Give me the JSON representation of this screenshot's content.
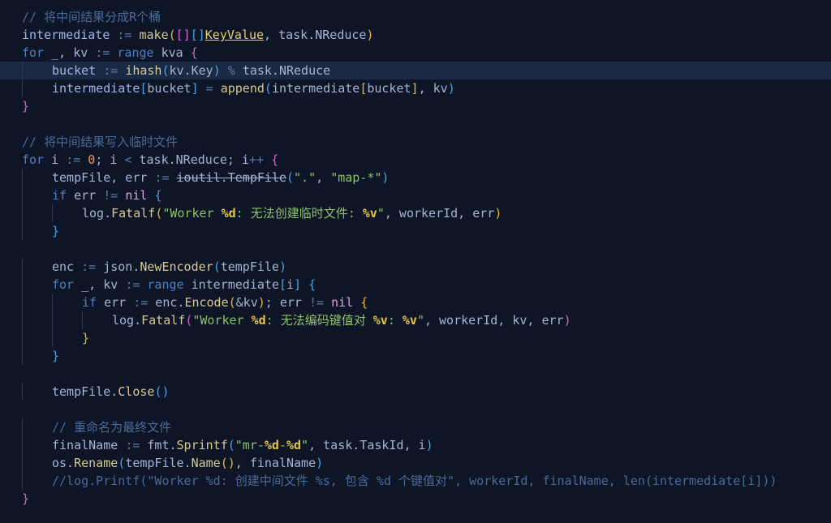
{
  "colors": {
    "background": "#0e1526",
    "line_highlight": "#1a2a44",
    "comment": "#4b6a98",
    "keyword": "#4d7fc4",
    "string": "#8cc36a",
    "function": "#d8c896",
    "bracket_gold": "#e6b93a",
    "bracket_magenta": "#d166c6",
    "bracket_blue": "#4aa3e0"
  },
  "editor": {
    "highlighted_line": 3,
    "lines": [
      {
        "indent": 0,
        "tokens": [
          {
            "t": "// 将中间结果分成R个桶",
            "c": "comment"
          }
        ]
      },
      {
        "indent": 0,
        "tokens": [
          {
            "t": "intermediate",
            "c": "var"
          },
          {
            "t": " := ",
            "c": "op"
          },
          {
            "t": "make",
            "c": "func"
          },
          {
            "t": "(",
            "c": "bracket1"
          },
          {
            "t": "[]",
            "c": "bracket2"
          },
          {
            "t": "[]",
            "c": "bracket3"
          },
          {
            "t": "KeyValue",
            "c": "type"
          },
          {
            "t": ", task.NReduce",
            "c": "plain"
          },
          {
            "t": ")",
            "c": "bracket1"
          }
        ]
      },
      {
        "indent": 0,
        "tokens": [
          {
            "t": "for",
            "c": "keyword"
          },
          {
            "t": " _, kv ",
            "c": "plain"
          },
          {
            "t": ":=",
            "c": "op"
          },
          {
            "t": " ",
            "c": "plain"
          },
          {
            "t": "range",
            "c": "keyword"
          },
          {
            "t": " kva ",
            "c": "plain"
          },
          {
            "t": "{",
            "c": "bracket2"
          }
        ]
      },
      {
        "indent": 1,
        "tokens": [
          {
            "t": "bucket",
            "c": "var"
          },
          {
            "t": " := ",
            "c": "op"
          },
          {
            "t": "ihash",
            "c": "func"
          },
          {
            "t": "(",
            "c": "bracket3"
          },
          {
            "t": "kv.Key",
            "c": "plain"
          },
          {
            "t": ")",
            "c": "bracket3"
          },
          {
            "t": " % ",
            "c": "op"
          },
          {
            "t": "task.NReduce",
            "c": "plain"
          }
        ]
      },
      {
        "indent": 1,
        "tokens": [
          {
            "t": "intermediate",
            "c": "var"
          },
          {
            "t": "[",
            "c": "bracket3"
          },
          {
            "t": "bucket",
            "c": "plain"
          },
          {
            "t": "]",
            "c": "bracket3"
          },
          {
            "t": " = ",
            "c": "op"
          },
          {
            "t": "append",
            "c": "func"
          },
          {
            "t": "(",
            "c": "bracket3"
          },
          {
            "t": "intermediate",
            "c": "plain"
          },
          {
            "t": "[",
            "c": "bracket1"
          },
          {
            "t": "bucket",
            "c": "plain"
          },
          {
            "t": "]",
            "c": "bracket1"
          },
          {
            "t": ", kv",
            "c": "plain"
          },
          {
            "t": ")",
            "c": "bracket3"
          }
        ]
      },
      {
        "indent": 0,
        "tokens": [
          {
            "t": "}",
            "c": "bracket2"
          }
        ]
      },
      {
        "indent": 0,
        "tokens": []
      },
      {
        "indent": 0,
        "tokens": [
          {
            "t": "// 将中间结果写入临时文件",
            "c": "comment"
          }
        ]
      },
      {
        "indent": 0,
        "tokens": [
          {
            "t": "for",
            "c": "keyword"
          },
          {
            "t": " i ",
            "c": "plain"
          },
          {
            "t": ":=",
            "c": "op"
          },
          {
            "t": " ",
            "c": "plain"
          },
          {
            "t": "0",
            "c": "number"
          },
          {
            "t": "; i ",
            "c": "plain"
          },
          {
            "t": "<",
            "c": "op"
          },
          {
            "t": " task.NReduce; i",
            "c": "plain"
          },
          {
            "t": "++",
            "c": "op"
          },
          {
            "t": " ",
            "c": "plain"
          },
          {
            "t": "{",
            "c": "bracket2"
          }
        ]
      },
      {
        "indent": 1,
        "tokens": [
          {
            "t": "tempFile, err ",
            "c": "plain"
          },
          {
            "t": ":=",
            "c": "op"
          },
          {
            "t": " ",
            "c": "plain"
          },
          {
            "t": "ioutil.TempFile",
            "c": "strike"
          },
          {
            "t": "(",
            "c": "bracket3"
          },
          {
            "t": "\".\"",
            "c": "string"
          },
          {
            "t": ", ",
            "c": "plain"
          },
          {
            "t": "\"map-*\"",
            "c": "string"
          },
          {
            "t": ")",
            "c": "bracket3"
          }
        ]
      },
      {
        "indent": 1,
        "tokens": [
          {
            "t": "if",
            "c": "keyword"
          },
          {
            "t": " err ",
            "c": "plain"
          },
          {
            "t": "!=",
            "c": "op"
          },
          {
            "t": " ",
            "c": "plain"
          },
          {
            "t": "nil",
            "c": "nil"
          },
          {
            "t": " ",
            "c": "plain"
          },
          {
            "t": "{",
            "c": "bracket3"
          }
        ]
      },
      {
        "indent": 2,
        "tokens": [
          {
            "t": "log.",
            "c": "plain"
          },
          {
            "t": "Fatalf",
            "c": "func"
          },
          {
            "t": "(",
            "c": "bracket1"
          },
          {
            "t": "\"Worker ",
            "c": "string"
          },
          {
            "t": "%d",
            "c": "format"
          },
          {
            "t": ": 无法创建临时文件: ",
            "c": "string"
          },
          {
            "t": "%v",
            "c": "format"
          },
          {
            "t": "\"",
            "c": "string"
          },
          {
            "t": ", workerId, err",
            "c": "plain"
          },
          {
            "t": ")",
            "c": "bracket1"
          }
        ]
      },
      {
        "indent": 1,
        "tokens": [
          {
            "t": "}",
            "c": "bracket3"
          }
        ]
      },
      {
        "indent": 0,
        "tokens": []
      },
      {
        "indent": 1,
        "tokens": [
          {
            "t": "enc ",
            "c": "plain"
          },
          {
            "t": ":=",
            "c": "op"
          },
          {
            "t": " json.",
            "c": "plain"
          },
          {
            "t": "NewEncoder",
            "c": "func"
          },
          {
            "t": "(",
            "c": "bracket3"
          },
          {
            "t": "tempFile",
            "c": "plain"
          },
          {
            "t": ")",
            "c": "bracket3"
          }
        ]
      },
      {
        "indent": 1,
        "tokens": [
          {
            "t": "for",
            "c": "keyword"
          },
          {
            "t": " _, kv ",
            "c": "plain"
          },
          {
            "t": ":=",
            "c": "op"
          },
          {
            "t": " ",
            "c": "plain"
          },
          {
            "t": "range",
            "c": "keyword"
          },
          {
            "t": " intermediate",
            "c": "plain"
          },
          {
            "t": "[",
            "c": "bracket3"
          },
          {
            "t": "i",
            "c": "plain"
          },
          {
            "t": "]",
            "c": "bracket3"
          },
          {
            "t": " ",
            "c": "plain"
          },
          {
            "t": "{",
            "c": "bracket3"
          }
        ]
      },
      {
        "indent": 2,
        "tokens": [
          {
            "t": "if",
            "c": "keyword"
          },
          {
            "t": " err ",
            "c": "plain"
          },
          {
            "t": ":=",
            "c": "op"
          },
          {
            "t": " enc.",
            "c": "plain"
          },
          {
            "t": "Encode",
            "c": "func"
          },
          {
            "t": "(",
            "c": "bracket1"
          },
          {
            "t": "&kv",
            "c": "plain"
          },
          {
            "t": ")",
            "c": "bracket1"
          },
          {
            "t": "; err ",
            "c": "plain"
          },
          {
            "t": "!=",
            "c": "op"
          },
          {
            "t": " ",
            "c": "plain"
          },
          {
            "t": "nil",
            "c": "nil"
          },
          {
            "t": " ",
            "c": "plain"
          },
          {
            "t": "{",
            "c": "bracket1"
          }
        ]
      },
      {
        "indent": 3,
        "tokens": [
          {
            "t": "log.",
            "c": "plain"
          },
          {
            "t": "Fatalf",
            "c": "func"
          },
          {
            "t": "(",
            "c": "bracket2"
          },
          {
            "t": "\"Worker ",
            "c": "string"
          },
          {
            "t": "%d",
            "c": "format"
          },
          {
            "t": ": 无法编码键值对 ",
            "c": "string"
          },
          {
            "t": "%v",
            "c": "format"
          },
          {
            "t": ": ",
            "c": "string"
          },
          {
            "t": "%v",
            "c": "format"
          },
          {
            "t": "\"",
            "c": "string"
          },
          {
            "t": ", workerId, kv, err",
            "c": "plain"
          },
          {
            "t": ")",
            "c": "bracket2"
          }
        ]
      },
      {
        "indent": 2,
        "tokens": [
          {
            "t": "}",
            "c": "bracket1"
          }
        ]
      },
      {
        "indent": 1,
        "tokens": [
          {
            "t": "}",
            "c": "bracket3"
          }
        ]
      },
      {
        "indent": 0,
        "tokens": []
      },
      {
        "indent": 1,
        "tokens": [
          {
            "t": "tempFile.",
            "c": "plain"
          },
          {
            "t": "Close",
            "c": "func"
          },
          {
            "t": "()",
            "c": "bracket3"
          }
        ]
      },
      {
        "indent": 0,
        "tokens": []
      },
      {
        "indent": 1,
        "tokens": [
          {
            "t": "// 重命名为最终文件",
            "c": "comment"
          }
        ]
      },
      {
        "indent": 1,
        "tokens": [
          {
            "t": "finalName ",
            "c": "plain"
          },
          {
            "t": ":=",
            "c": "op"
          },
          {
            "t": " fmt.",
            "c": "plain"
          },
          {
            "t": "Sprintf",
            "c": "func"
          },
          {
            "t": "(",
            "c": "bracket3"
          },
          {
            "t": "\"mr-",
            "c": "string"
          },
          {
            "t": "%d",
            "c": "format"
          },
          {
            "t": "-",
            "c": "string"
          },
          {
            "t": "%d",
            "c": "format"
          },
          {
            "t": "\"",
            "c": "string"
          },
          {
            "t": ", task.TaskId, i",
            "c": "plain"
          },
          {
            "t": ")",
            "c": "bracket3"
          }
        ]
      },
      {
        "indent": 1,
        "tokens": [
          {
            "t": "os.",
            "c": "plain"
          },
          {
            "t": "Rename",
            "c": "func"
          },
          {
            "t": "(",
            "c": "bracket3"
          },
          {
            "t": "tempFile.",
            "c": "plain"
          },
          {
            "t": "Name",
            "c": "func"
          },
          {
            "t": "()",
            "c": "bracket1"
          },
          {
            "t": ", finalName",
            "c": "plain"
          },
          {
            "t": ")",
            "c": "bracket3"
          }
        ]
      },
      {
        "indent": 1,
        "tokens": [
          {
            "t": "//log.Printf(\"Worker %d: 创建中间文件 %s, 包含 %d 个键值对\", workerId, finalName, len(intermediate[i]))",
            "c": "comment"
          }
        ]
      },
      {
        "indent": 0,
        "tokens": [
          {
            "t": "}",
            "c": "bracket2"
          }
        ]
      }
    ]
  }
}
